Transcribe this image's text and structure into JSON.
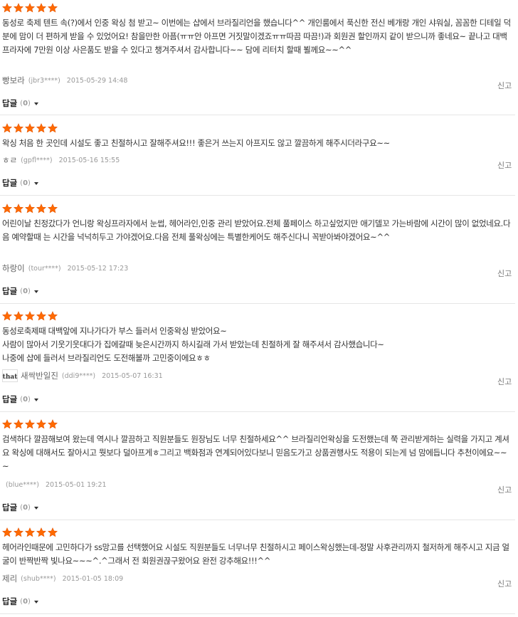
{
  "colors": {
    "star": "#ff6a00",
    "star_stroke": "#e55500"
  },
  "icons": {
    "star": "star-icon",
    "caret": "caret-down-icon"
  },
  "reviews": [
    {
      "rating": 5,
      "text": "동성로 축제 텐트 속(?)에서 인중 왁싱 첨 받고~ 이번에는 샵에서 브라질리언을 했습니다^^ 개인룸에서 푹신한 전신 베개랑 개인 샤워실, 꼼꼼한 디테일 덕분에 맘이 더 편하게 받을 수 있었어요! 참을만한 아픔(ㅠㅠ안 아프면 거짓말이겠죠ㅠㅠ따끔 따끔!)과 회원권 할인까지 같이 받으니까 좋네요~ 끝나고 대백프라자에 7만원 이상 사은품도 받을 수 있다고 챙겨주셔서 감사합니다~~ 담에 리터치 할때 뵐께요~~^^",
      "author": "빵보라",
      "author_id": "(jbr3****)",
      "date": "2015-05-29 14:48",
      "report": "신고",
      "reply_label": "답글",
      "reply_count": "0"
    },
    {
      "rating": 5,
      "text": "왁싱 처음 한 곳인데 시설도 좋고 친절하시고 잘해주셔요!!! 좋은거 쓰는지 아프지도 않고 깔끔하게 해주시더라구요~~",
      "author": "ㅎㄹ",
      "author_id": "(gpfl****)",
      "date": "2015-05-16 15:55",
      "report": "신고",
      "reply_label": "답글",
      "reply_count": "0"
    },
    {
      "rating": 5,
      "text": "어린이날 친정갔다가 언니랑 왁싱프라자에서 눈썹, 헤어라인,인중 관리 받았어요.전체 풀페이스 하고싶었지만 애기델꼬 가는바람에 시간이 많이 없었네요.다음 예약할때 는 시간을 넉넉히두고 가야겠어요.다음 전체 풀왁싱에는 특별한케어도 해주신다니 꼭받아봐야겠어요~^^",
      "author": "하랑이",
      "author_id": "(tour****)",
      "date": "2015-05-12 17:23",
      "report": "신고",
      "reply_label": "답글",
      "reply_count": "0"
    },
    {
      "rating": 5,
      "text": "동성로축제때 대백앞에 지나가다가 부스 들러서 인중왁싱 받았어요~\n사람이 많아서 기웃기웃대다가 집에갈때 늦은시간까지 하시길래 가서 받았는데 친절하게 잘 해주셔서 감사했습니다~\n나중에 샵에 들러서 브라질리언도 도전해볼까 고민중이에요ㅎㅎ",
      "author": "새싹반일진",
      "author_id": "(ddi9****)",
      "date": "2015-05-07 16:31",
      "avatar_text": "that",
      "report": "신고",
      "reply_label": "답글",
      "reply_count": "0"
    },
    {
      "rating": 5,
      "text": "검색하다 깔끔해보여 왔는데 역시나 깔끔하고 직원분들도 원장님도 너무 친절하세요^^ 브라질리언왁싱을 도전했는데 쭉 관리받게하는 실력을 가지고 계셔요 왁싱에 대해서도 잘아시고 뭣보다 덜아프게ㅎ그리고 백화점과 연계되어있다보니 믿음도가고 상품권행사도 적용이 되는게 넘 맘에듭니다 추천이에요~~~",
      "author": "",
      "author_id": "(blue****)",
      "date": "2015-05-01 19:21",
      "report": "신고",
      "reply_label": "답글",
      "reply_count": "0"
    },
    {
      "rating": 5,
      "text": "헤어라인때문에 고민하다가 ss망고를 선택했어요 시설도 직원분들도 너무너무 친절하시고 페이스왁싱했는데-정말 사후관리까지 철저하게 해주시고 지금 얼굴이 반짝반짝 빛나요~~~^.^그래서 전 회원권끊구왔어요 완전 강추해요!!!^^",
      "author": "제리",
      "author_id": "(shub****)",
      "date": "2015-01-05 18:09",
      "report": "신고",
      "reply_label": "답글",
      "reply_count": "0"
    }
  ]
}
